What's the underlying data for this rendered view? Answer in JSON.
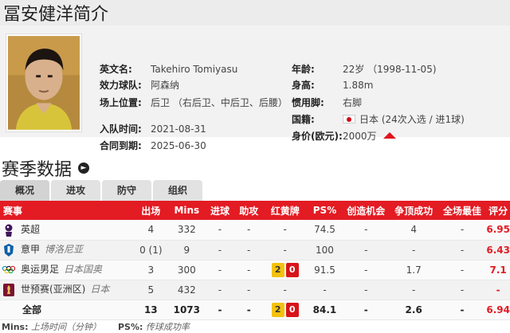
{
  "page_title": "冨安健洋简介",
  "profile": {
    "left": [
      {
        "label": "英文名:",
        "value": "Takehiro Tomiyasu"
      },
      {
        "label": "效力球队:",
        "value": "阿森纳"
      },
      {
        "label": "场上位置:",
        "value": "后卫 （右后卫、中后卫、后腰）"
      },
      {
        "label": "入队时间:",
        "value": "2021-08-31"
      },
      {
        "label": "合同到期:",
        "value": "2025-06-30"
      }
    ],
    "right": [
      {
        "label": "年龄:",
        "value": "22岁 （1998-11-05)"
      },
      {
        "label": "身高:",
        "value": "1.88m"
      },
      {
        "label": "惯用脚:",
        "value": "右脚"
      },
      {
        "label": "国籍:",
        "value": "日本 (24次入选 / 进1球)"
      },
      {
        "label": "身价(欧元):",
        "value": "2000万"
      }
    ],
    "value_trend_icon": "up-arrow-icon"
  },
  "season_section": {
    "title": "赛季数据",
    "more_icon": "arrow-right-circle-icon"
  },
  "tabs": [
    "概况",
    "进攻",
    "防守",
    "组织"
  ],
  "active_tab": 0,
  "table": {
    "headers": [
      "赛事",
      "出场",
      "Mins",
      "进球",
      "助攻",
      "红黄牌",
      "PS%",
      "创造机会",
      "争顶成功",
      "全场最佳",
      "评分"
    ],
    "rows": [
      {
        "icon": "premier-league-icon",
        "name": "英超",
        "sub": "",
        "apps": "4",
        "mins": "332",
        "goals": "-",
        "assists": "-",
        "cards": "-",
        "ps": "74.5",
        "chances": "-",
        "aerial": "4",
        "motm": "-",
        "rating": "6.95"
      },
      {
        "icon": "serie-a-icon",
        "name": "意甲",
        "sub": "博洛尼亚",
        "apps": "0 (1)",
        "mins": "9",
        "goals": "-",
        "assists": "-",
        "cards": "-",
        "ps": "100",
        "chances": "-",
        "aerial": "-",
        "motm": "-",
        "rating": "6.43"
      },
      {
        "icon": "olympic-rings-icon",
        "name": "奥运男足",
        "sub": "日本国奥",
        "apps": "3",
        "mins": "300",
        "goals": "-",
        "assists": "-",
        "yellow": "2",
        "red": "0",
        "ps": "91.5",
        "chances": "-",
        "aerial": "1.7",
        "motm": "-",
        "rating": "7.1"
      },
      {
        "icon": "world-cup-qualifier-icon",
        "name": "世预赛(亚洲区)",
        "sub": "日本",
        "apps": "5",
        "mins": "432",
        "goals": "-",
        "assists": "-",
        "cards": "-",
        "ps": "-",
        "chances": "-",
        "aerial": "-",
        "motm": "-",
        "rating": "-"
      }
    ],
    "total": {
      "name": "全部",
      "apps": "13",
      "mins": "1073",
      "goals": "-",
      "assists": "-",
      "yellow": "2",
      "red": "0",
      "ps": "84.1",
      "chances": "-",
      "aerial": "2.6",
      "motm": "-",
      "rating": "6.94"
    }
  },
  "footnote": {
    "mins_key": "Mins:",
    "mins_desc": "上场时间（分钟）",
    "ps_key": "PS%:",
    "ps_desc": "传球成功率"
  },
  "colors": {
    "accent": "#e31b23",
    "yellow_card": "#f4c20d",
    "red_card": "#d7141a"
  }
}
